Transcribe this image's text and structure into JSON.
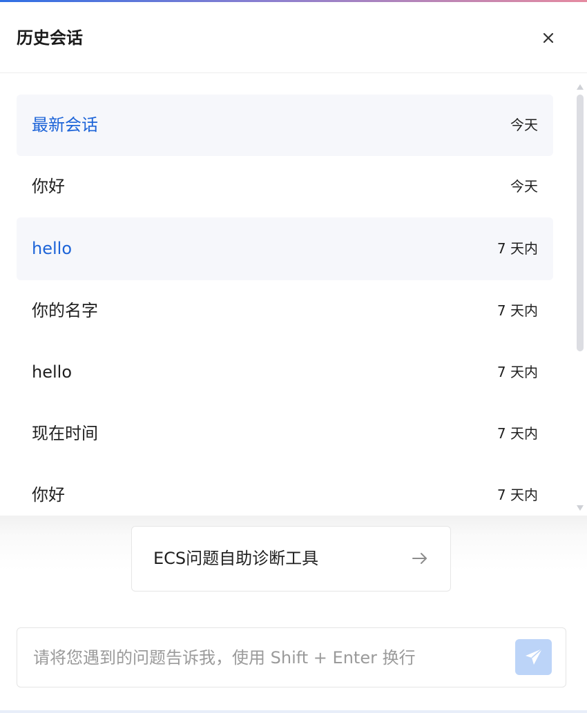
{
  "header": {
    "title": "历史会话",
    "close_icon": "close-icon"
  },
  "history": {
    "items": [
      {
        "title": "最新会话",
        "time": "今天",
        "active": true
      },
      {
        "title": "你好",
        "time": "今天",
        "active": false
      },
      {
        "title": "hello",
        "time": "7 天内",
        "active": true
      },
      {
        "title": "你的名字",
        "time": "7 天内",
        "active": false
      },
      {
        "title": "hello",
        "time": "7 天内",
        "active": false
      },
      {
        "title": "现在时间",
        "time": "7 天内",
        "active": false
      },
      {
        "title": "你好",
        "time": "7 天内",
        "active": false
      }
    ]
  },
  "tool": {
    "label": "ECS问题自助诊断工具",
    "icon": "arrow-right-icon"
  },
  "composer": {
    "placeholder": "请将您遇到的问题告诉我，使用 Shift + Enter 换行",
    "value": "",
    "send_icon": "send-icon"
  },
  "colors": {
    "accent": "#1d64d8",
    "active_bg": "#f6f7fb",
    "send_bg": "#bcd4f8"
  }
}
